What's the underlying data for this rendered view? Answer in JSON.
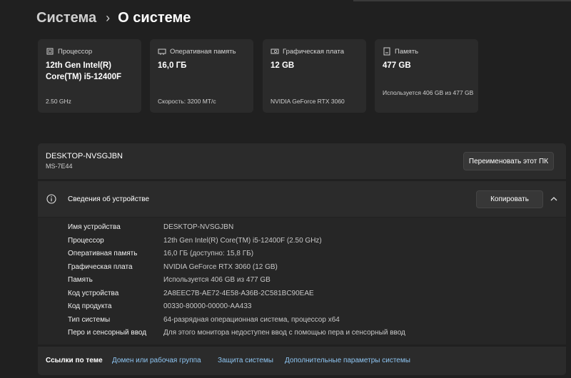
{
  "breadcrumb": {
    "parent": "Система",
    "separator": "›",
    "current": "О системе"
  },
  "cards": [
    {
      "icon": "processor-icon",
      "title": "Процессор",
      "value": "12th Gen Intel(R) Core(TM) i5-12400F",
      "footer": "2.50 GHz"
    },
    {
      "icon": "memory-icon",
      "title": "Оперативная память",
      "value": "16,0 ГБ",
      "footer": "Скорость: 3200 МТ/с"
    },
    {
      "icon": "graphics-card-icon",
      "title": "Графическая плата",
      "value": "12 GB",
      "footer": "NVIDIA GeForce RTX 3060"
    },
    {
      "icon": "storage-icon",
      "title": "Память",
      "value": "477 GB",
      "footer": "Используется 406 GB из 477 GB"
    }
  ],
  "pc": {
    "name": "DESKTOP-NVSGJBN",
    "model": "MS-7E44",
    "rename_label": "Переименовать этот ПК"
  },
  "specs": {
    "title": "Сведения об устройстве",
    "copy_label": "Копировать",
    "rows": [
      {
        "label": "Имя устройства",
        "value": "DESKTOP-NVSGJBN"
      },
      {
        "label": "Процессор",
        "value": "12th Gen Intel(R) Core(TM) i5-12400F (2.50 GHz)"
      },
      {
        "label": "Оперативная память",
        "value": "16,0 ГБ (доступно: 15,8 ГБ)"
      },
      {
        "label": "Графическая плата",
        "value": "NVIDIA GeForce RTX 3060 (12 GB)"
      },
      {
        "label": "Память",
        "value": "Используется 406 GB из 477 GB"
      },
      {
        "label": "Код устройства",
        "value": "2A8EEC7B-AE72-4E58-A36B-2C581BC90EAE"
      },
      {
        "label": "Код продукта",
        "value": "00330-80000-00000-AA433"
      },
      {
        "label": "Тип системы",
        "value": "64-разрядная операционная система, процессор x64"
      },
      {
        "label": "Перо и сенсорный ввод",
        "value": "Для этого монитора недоступен ввод с помощью пера и сенсорный ввод"
      }
    ]
  },
  "related": {
    "label": "Ссылки по теме",
    "links": [
      "Домен или рабочая группа",
      "Защита системы",
      "Дополнительные параметры системы"
    ]
  },
  "colors": {
    "background": "#202020",
    "card": "#2b2b2b",
    "link": "#8ec5f2"
  }
}
